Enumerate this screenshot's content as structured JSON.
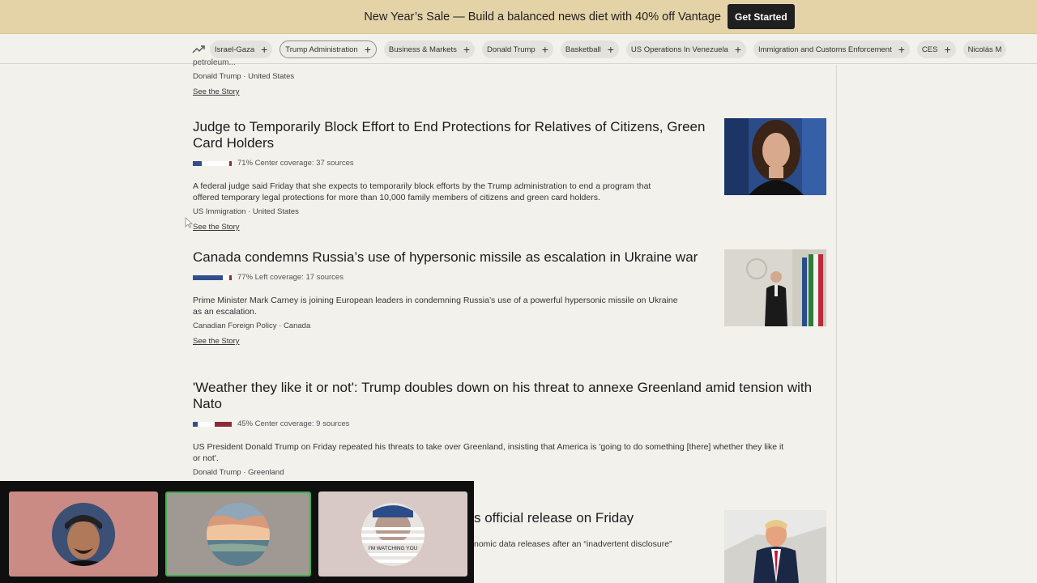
{
  "banner": {
    "text": "New Year’s Sale — Build a balanced news diet with 40% off Vantage",
    "button": "Get Started"
  },
  "topics": [
    {
      "label": "Israel-Gaza",
      "active": false
    },
    {
      "label": "Trump Administration",
      "active": true
    },
    {
      "label": "Business & Markets",
      "active": false
    },
    {
      "label": "Donald Trump",
      "active": false
    },
    {
      "label": "Basketball",
      "active": false
    },
    {
      "label": "US Operations In Venezuela",
      "active": false
    },
    {
      "label": "Immigration and Customs Enforcement",
      "active": false
    },
    {
      "label": "CES",
      "active": false
    },
    {
      "label": "Nicolás M",
      "active": false
    }
  ],
  "prev_story": {
    "fade_text": "petroleum...",
    "meta": "Donald Trump · United States",
    "link": "See the Story"
  },
  "stories": [
    {
      "title": "Judge to Temporarily Block Effort to End Protections for Relatives of Citizens, Green Card Holders",
      "coverage": "71% Center coverage: 37 sources",
      "bias": {
        "left": 0.22,
        "center": 0.71,
        "right": 0.07
      },
      "summary": "A federal judge said Friday that she expects to temporarily block efforts by the Trump administration to end a program that offered temporary legal protections for more than 10,000 family members of citizens and green card holders.",
      "meta": "US Immigration · United States",
      "link": "See the Story"
    },
    {
      "title": "Canada condemns Russia’s use of hypersonic missile as escalation in Ukraine war",
      "coverage": "77% Left coverage: 17 sources",
      "bias": {
        "left": 0.77,
        "center": 0.17,
        "right": 0.06
      },
      "summary": "Prime Minister Mark Carney is joining European leaders in condemning Russia’s use of a powerful hypersonic missile on Ukraine as an escalation.",
      "meta": "Canadian Foreign Policy · Canada",
      "link": "See the Story"
    },
    {
      "title": "'Weather they like it or not': Trump doubles down on his threat to annexe Greenland amid tension with Nato",
      "coverage": "45% Center coverage: 9 sources",
      "bias": {
        "left": 0.12,
        "center": 0.45,
        "right": 0.43
      },
      "summary": "US President Donald Trump on Friday repeated his threats to take over Greenland, insisting that America is 'going to do something [there] whether they like it or not'.",
      "meta": "Donald Trump · Greenland",
      "link": ""
    },
    {
      "title_visible": "s official release on Friday",
      "summary_visible": "nomic data releases after an “inadvertent disclosure”"
    }
  ],
  "tiles": [
    {
      "name": "participant-1",
      "bg": "#c98b84",
      "label": ""
    },
    {
      "name": "participant-2",
      "bg": "#9f9893",
      "label": ""
    },
    {
      "name": "participant-3",
      "bg": "#d9c9c6",
      "label": "I'M WATCHING YOU"
    }
  ],
  "colors": {
    "left": "#2f4f8f",
    "center": "#ffffff",
    "right": "#8c2b36"
  }
}
